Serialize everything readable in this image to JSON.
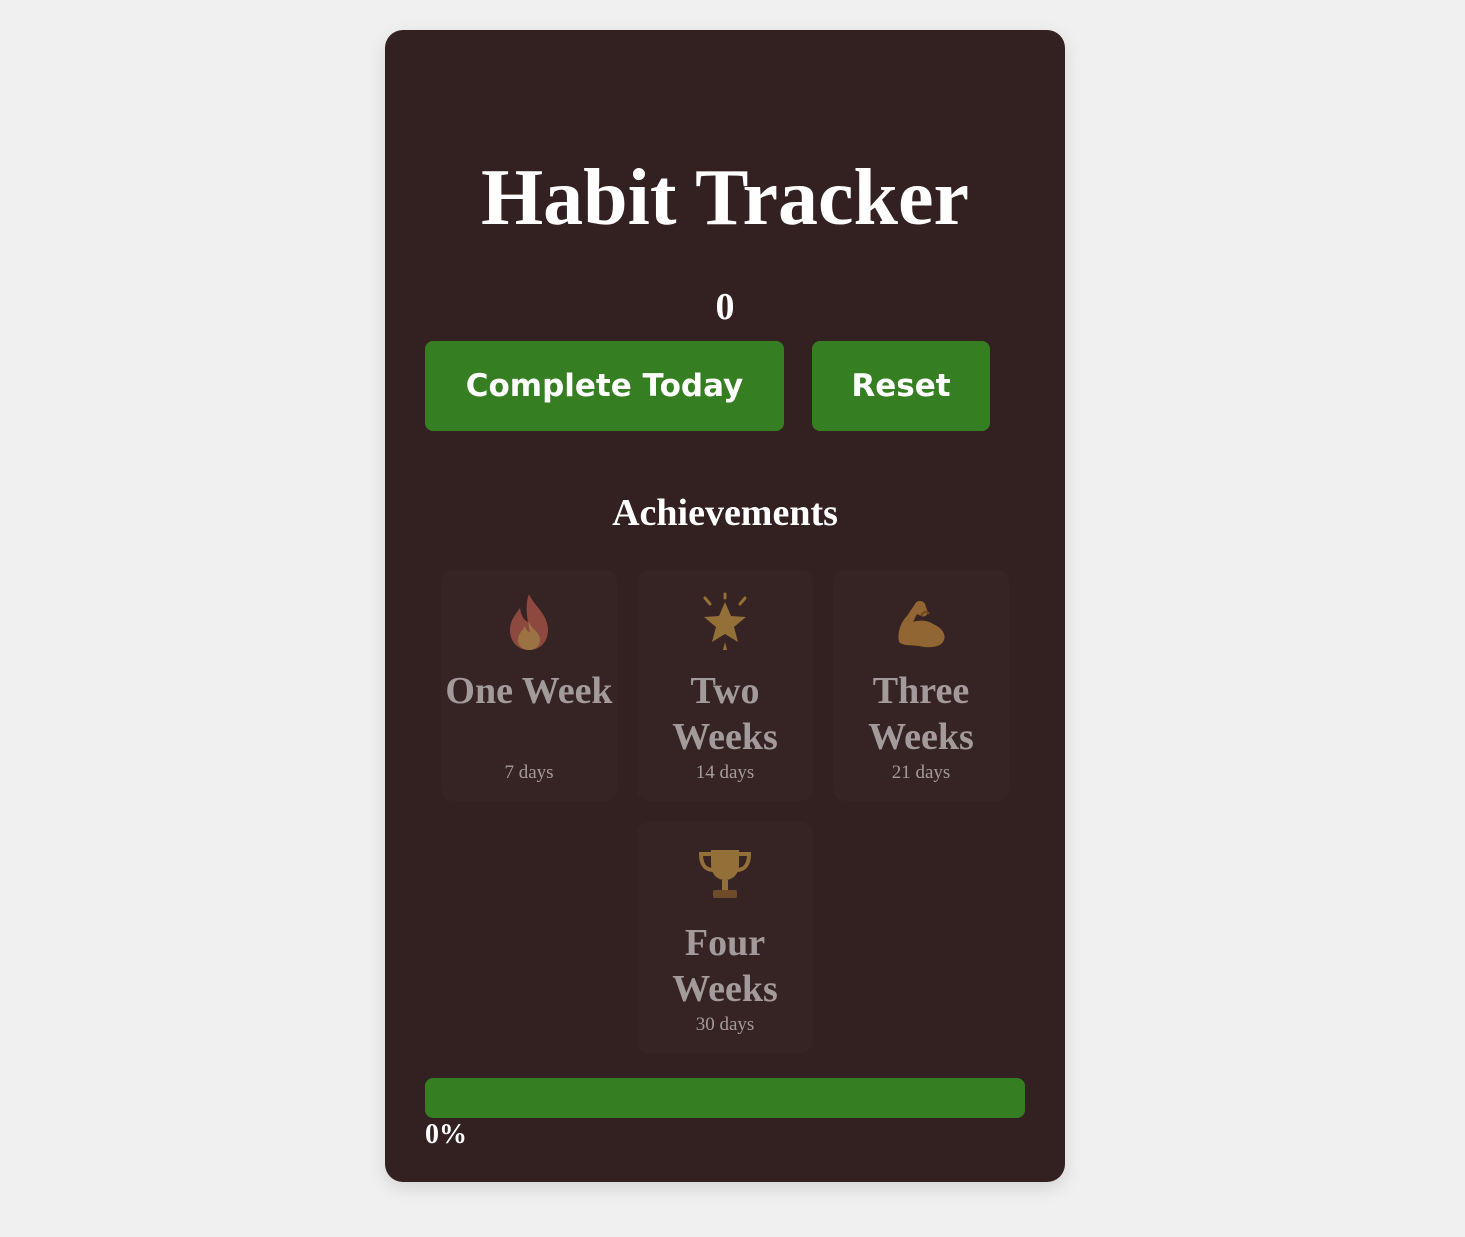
{
  "app": {
    "title": "Habit Tracker",
    "streak_count": "0"
  },
  "actions": {
    "complete_label": "Complete Today",
    "reset_label": "Reset"
  },
  "achievements": {
    "heading": "Achievements",
    "items": [
      {
        "icon": "fire-icon",
        "name": "One Week",
        "days": "7 days",
        "unlocked": false
      },
      {
        "icon": "star-icon",
        "name": "Two Weeks",
        "days": "14 days",
        "unlocked": false
      },
      {
        "icon": "flexed-biceps-icon",
        "name": "Three Weeks",
        "days": "21 days",
        "unlocked": false
      },
      {
        "icon": "trophy-icon",
        "name": "Four Weeks",
        "days": "30 days",
        "unlocked": false
      }
    ]
  },
  "progress": {
    "value": 0,
    "label": "0%"
  },
  "colors": {
    "page_background": "#f0f0f0",
    "card_background": "#332021",
    "accent_green": "#367e22",
    "text": "#ffffff"
  }
}
